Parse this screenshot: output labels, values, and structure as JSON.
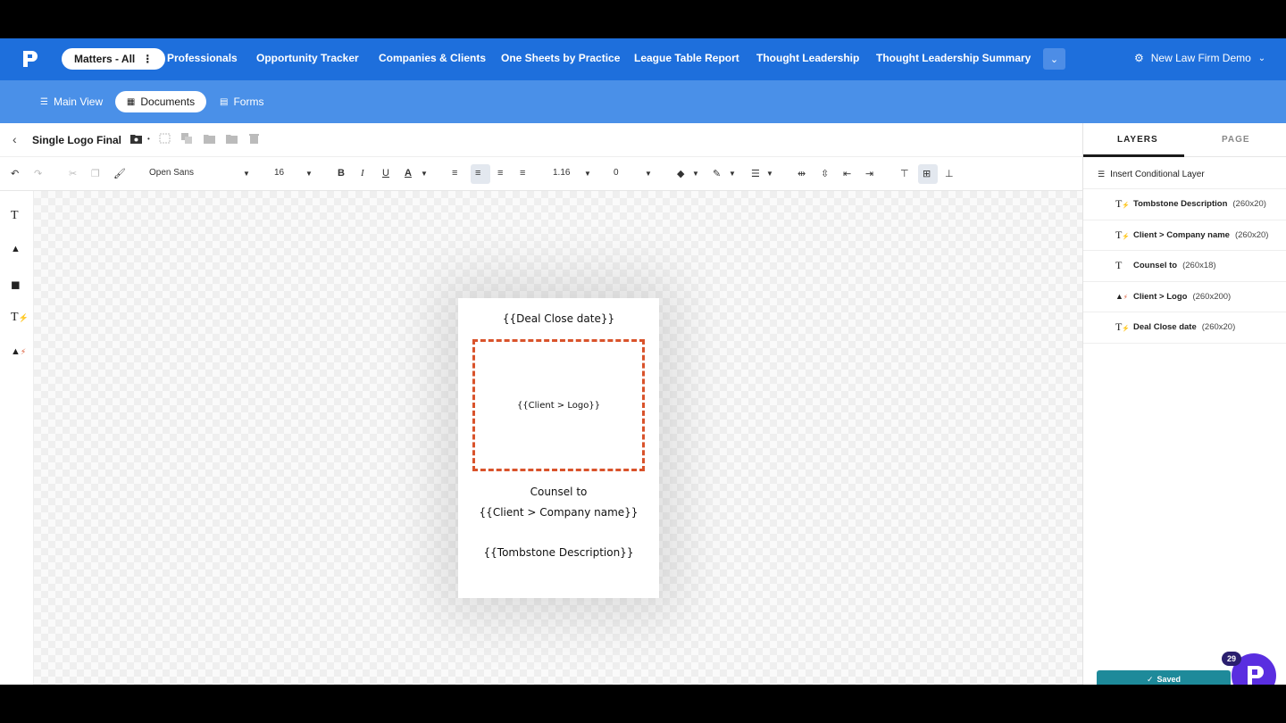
{
  "topnav": {
    "pill_label": "Matters - All",
    "items": [
      "Professionals",
      "Opportunity Tracker",
      "Companies & Clients",
      "One Sheets by Practice",
      "League Table Report",
      "Thought Leadership",
      "Thought Leadership Summary"
    ],
    "firm_name": "New Law Firm Demo"
  },
  "subnav": {
    "main_view": "Main View",
    "documents": "Documents",
    "forms": "Forms"
  },
  "docbar": {
    "title": "Single Logo Final"
  },
  "format": {
    "font_family": "Open Sans",
    "font_size": "16",
    "line_height": "1.16",
    "letter_spacing": "0"
  },
  "page": {
    "deal_date": "{{Deal Close date}}",
    "logo": "{{Client > Logo}}",
    "counsel": "Counsel to",
    "company": "{{Client > Company name}}",
    "tombstone": "{{Tombstone Description}}"
  },
  "rpanel": {
    "tab_layers": "LAYERS",
    "tab_page": "PAGE",
    "insert_label": "Insert Conditional Layer",
    "layers": [
      {
        "name": "Tombstone Description",
        "size": "(260x20)",
        "icon": "dynamic-text-icon"
      },
      {
        "name": "Client > Company name",
        "size": "(260x20)",
        "icon": "dynamic-text-icon"
      },
      {
        "name": "Counsel to",
        "size": "(260x18)",
        "icon": "text-icon"
      },
      {
        "name": "Client > Logo",
        "size": "(260x200)",
        "icon": "dynamic-image-icon"
      },
      {
        "name": "Deal Close date",
        "size": "(260x20)",
        "icon": "dynamic-text-icon"
      }
    ]
  },
  "status": {
    "saved": "Saved",
    "badge": "29"
  },
  "colors": {
    "primary": "#1e6fdc",
    "secondary": "#4a90e8",
    "logo_border": "#d9532b",
    "saved": "#1e8a9a",
    "fab": "#5a2ee0"
  }
}
